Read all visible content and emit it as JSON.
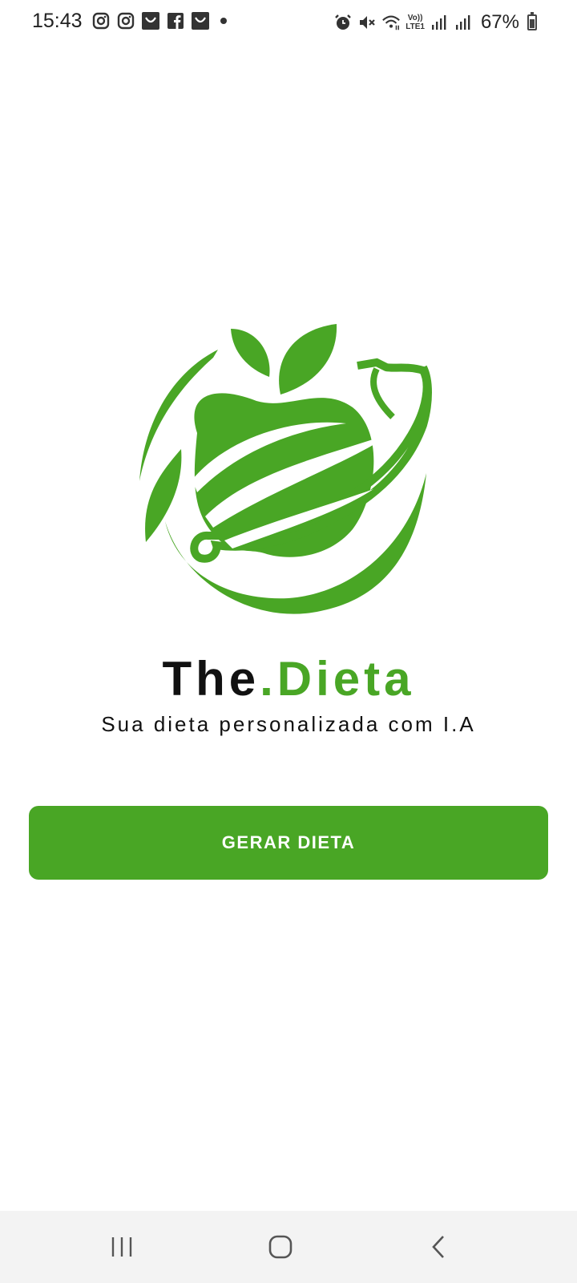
{
  "status_bar": {
    "time": "15:43",
    "battery": "67%",
    "battery_level": 0.67,
    "notification_icons": [
      "instagram-icon",
      "instagram-icon",
      "shop-bag-icon",
      "facebook-icon",
      "shop-bag-icon"
    ],
    "system_icons": [
      "alarm-icon",
      "mute-icon",
      "wifi-icon",
      "volte-lte-icon",
      "signal-icon",
      "signal-icon"
    ],
    "lte_label_top": "Vo))",
    "lte_label_bottom": "LTE1"
  },
  "brand": {
    "part1": "The",
    "part2": ".Dieta",
    "accent_color": "#49a625"
  },
  "tagline": "Sua dieta personalizada com I.A",
  "actions": {
    "generate_label": "GERAR DIETA"
  },
  "nav_bar": {
    "buttons": [
      "recent-apps-icon",
      "home-icon",
      "back-icon"
    ]
  }
}
